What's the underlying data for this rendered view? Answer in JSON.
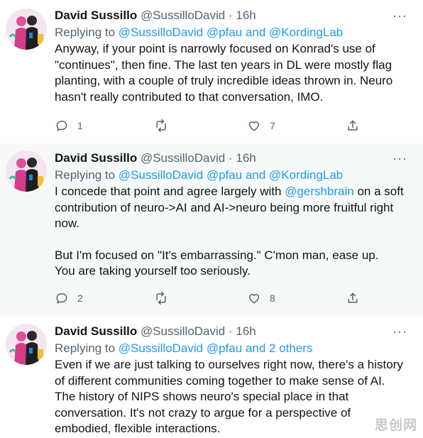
{
  "tweets": [
    {
      "name": "David Sussillo",
      "handle": "@SussilloDavid",
      "separator": "·",
      "time": "16h",
      "more": "···",
      "reply_prefix": "Replying to",
      "reply_mentions": [
        "@SussilloDavid",
        "@pfau",
        "and",
        "@KordingLab"
      ],
      "lines": [
        "Anyway, if your point is narrowly focused on Konrad's use of",
        "\"continues\", then fine. The last ten years in DL were mostly flag",
        "planting, with a couple of truly incredible ideas thrown in. Neuro",
        "hasn't really contributed to that conversation, IMO."
      ],
      "replies": "1",
      "retweets": "",
      "likes": "7"
    },
    {
      "name": "David Sussillo",
      "handle": "@SussilloDavid",
      "separator": "·",
      "time": "16h",
      "more": "···",
      "reply_prefix": "Replying to",
      "reply_mentions": [
        "@SussilloDavid",
        "@pfau",
        "and",
        "@KordingLab"
      ],
      "line1_before": "I concede that point and agree largely with ",
      "line1_mention": "@gershbrain",
      "line1_after": " on a soft",
      "lines_a": [
        "contribution of neuro->AI and AI->neuro being more fruitful right",
        "now."
      ],
      "lines_b": [
        "But I'm focused on \"It's embarrassing.\"  C'mon man, ease up.",
        "You are taking yourself too seriously."
      ],
      "replies": "2",
      "retweets": "",
      "likes": "8"
    },
    {
      "name": "David Sussillo",
      "handle": "@SussilloDavid",
      "separator": "·",
      "time": "16h",
      "more": "···",
      "reply_prefix": "Replying to",
      "reply_mentions": [
        "@SussilloDavid",
        "@pfau",
        "and 2 others"
      ],
      "lines": [
        "Even if we are just talking to ourselves right now, there's a history",
        "of different communities coming together to make sense of AI.",
        "The history of NIPS shows neuro's special place in that",
        "conversation. It's not crazy to argue for a perspective of",
        "embodied, flexible interactions."
      ]
    }
  ],
  "icons": [
    "reply-icon",
    "retweet-icon",
    "like-icon",
    "share-icon",
    "more-icon",
    "avatar"
  ],
  "colors": {
    "link": "#1d9bf0",
    "secondary_text": "#536471",
    "primary_text": "#0f1419",
    "highlight_bg": "#f7f9f9",
    "thread_line": "#cfd9de"
  },
  "watermark": "思创网"
}
